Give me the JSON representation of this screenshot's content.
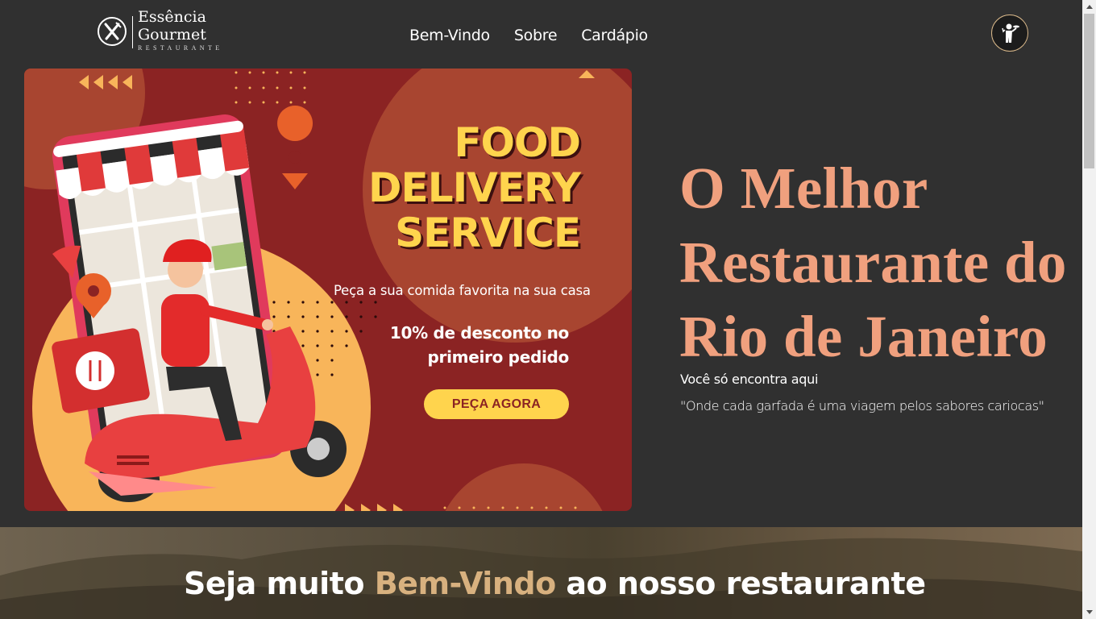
{
  "header": {
    "logo_line1": "Essência",
    "logo_line2": "Gourmet",
    "logo_sub": "RESTAURANTE",
    "nav": [
      "Bem-Vindo",
      "Sobre",
      "Cardápio"
    ]
  },
  "banner": {
    "headline": [
      "FOOD",
      "DELIVERY",
      "SERVICE"
    ],
    "subline": "Peça a sua comida favorita na sua casa",
    "discount_line1": "10% de desconto no",
    "discount_line2": "primeiro pedido",
    "cta": "PEÇA AGORA"
  },
  "hero": {
    "title": "O Melhor Restaurante do Rio de Janeiro",
    "subtitle": "Você só encontra aqui",
    "quote": "\"Onde cada garfada é uma viagem pelos sabores cariocas\""
  },
  "welcome": {
    "prefix": "Seja muito ",
    "highlight": "Bem-Vindo",
    "suffix": " ao nosso restaurante"
  },
  "colors": {
    "background": "#303030",
    "accent_salmon": "#f0a07e",
    "accent_gold": "#d8b17f",
    "banner_red": "#8b2323",
    "banner_yellow": "#ffd44d"
  },
  "icons": [
    "fork-knife-logo-icon",
    "waiter-icon",
    "chevron-up-icon",
    "chevron-down-icon"
  ]
}
